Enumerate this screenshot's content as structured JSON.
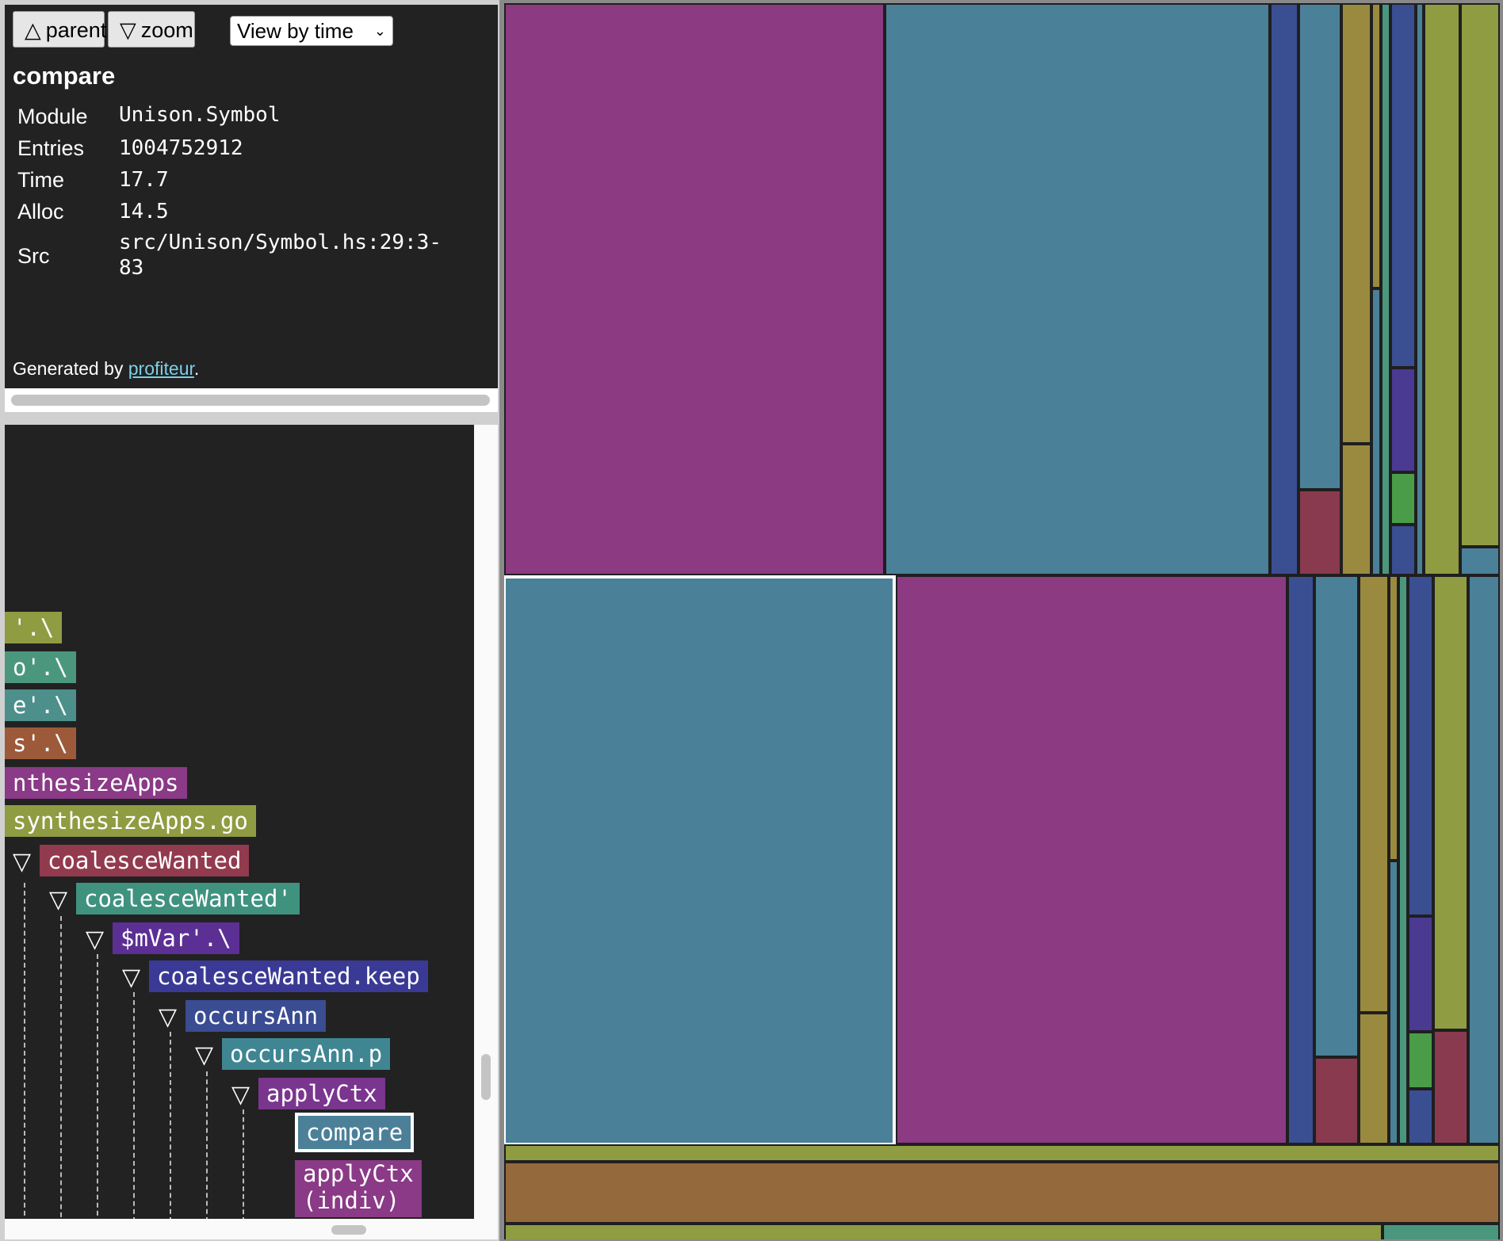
{
  "toolbar": {
    "parent_label": "parent",
    "zoom_label": "zoom",
    "view_options": [
      "View by time"
    ],
    "view_selected": "View by time"
  },
  "info": {
    "title": "compare",
    "rows": [
      {
        "key": "Module",
        "value": "Unison.Symbol"
      },
      {
        "key": "Entries",
        "value": "1004752912"
      },
      {
        "key": "Time",
        "value": "17.7"
      },
      {
        "key": "Alloc",
        "value": "14.5"
      },
      {
        "key": "Src",
        "value": "src/Unison/Symbol.hs:29:3-\n83"
      }
    ],
    "generated_prefix": "Generated by ",
    "generated_link": "profiteur",
    "generated_suffix": "."
  },
  "tree": {
    "nodes": [
      {
        "label": "'.\\",
        "color": "#8f9c42"
      },
      {
        "label": "o'.\\",
        "color": "#4a977e"
      },
      {
        "label": "e'.\\",
        "color": "#4c8f8b"
      },
      {
        "label": "s'.\\",
        "color": "#9c5a3a"
      },
      {
        "label": "nthesizeApps",
        "color": "#8a3a86"
      },
      {
        "label": "synthesizeApps.go",
        "color": "#8f9c42"
      },
      {
        "label": "coalesceWanted",
        "color": "#923a4e",
        "expanded": true
      },
      {
        "label": "coalesceWanted'",
        "color": "#3f927e",
        "expanded": true
      },
      {
        "label": "$mVar'.\\",
        "color": "#5c2f94",
        "expanded": true
      },
      {
        "label": "coalesceWanted.keep",
        "color": "#3a3a96",
        "expanded": true
      },
      {
        "label": "occursAnn",
        "color": "#3a4c92",
        "expanded": true
      },
      {
        "label": "occursAnn.p",
        "color": "#3f8692",
        "expanded": true
      },
      {
        "label": "applyCtx",
        "color": "#7a358e",
        "expanded": true
      },
      {
        "label": "compare",
        "color": "#4c8099",
        "selected": true
      },
      {
        "label": "applyCtx\n(indiv)",
        "color": "#8a3a86"
      }
    ]
  },
  "colors": {
    "magenta": "#8c3a82",
    "steel": "#4b8099",
    "olive": "#8f9c42",
    "navy": "#3a4e92",
    "mustard": "#9a8a40",
    "crimson": "#8a3a4e",
    "green": "#4a9c48",
    "brown": "#946a3c",
    "teal": "#4a977e",
    "purple": "#4a3a92",
    "panel_bg": "#222222",
    "link": "#7ccfe8"
  }
}
